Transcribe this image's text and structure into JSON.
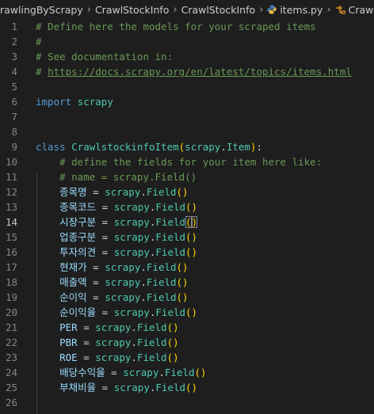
{
  "breadcrumb": {
    "items": [
      "rawlingByScrapy",
      "CrawlStockInfo",
      "CrawlStockInfo",
      "items.py",
      "CrawlstockinfoItem"
    ]
  },
  "editor": {
    "current_line": 14,
    "lines": [
      {
        "n": "1",
        "t": "# Define here the models for your scraped items"
      },
      {
        "n": "2",
        "t": "#"
      },
      {
        "n": "3",
        "t": "# See documentation in:"
      },
      {
        "n": "4",
        "t": "# ",
        "link": "https://docs.scrapy.org/en/latest/topics/items.html"
      },
      {
        "n": "5",
        "t": "import scrapy"
      },
      {
        "n": "6",
        "t": ""
      },
      {
        "n": "7",
        "t": ""
      },
      {
        "n": "8",
        "t": "class CrawlstockinfoItem(scrapy.Item):"
      },
      {
        "n": "9",
        "t": "    # define the fields for your item here like:"
      },
      {
        "n": "10",
        "t": "    # name = scrapy.Field()"
      },
      {
        "n": "11",
        "t": "    종목명 = scrapy.Field()"
      },
      {
        "n": "12",
        "t": "    종목코드 = scrapy.Field()"
      },
      {
        "n": "13",
        "t": "    시장구분 = scrapy.Field()"
      },
      {
        "n": "14",
        "t": "    업종구분 = scrapy.Field()"
      },
      {
        "n": "15",
        "t": "    투자의견 = scrapy.Field()"
      },
      {
        "n": "16",
        "t": "    현재가 = scrapy.Field()"
      },
      {
        "n": "17",
        "t": "    매출액 = scrapy.Field()"
      },
      {
        "n": "18",
        "t": "    순이익 = scrapy.Field()"
      },
      {
        "n": "19",
        "t": "    순이익율 = scrapy.Field()"
      },
      {
        "n": "20",
        "t": "    PER = scrapy.Field()"
      },
      {
        "n": "21",
        "t": "    PBR = scrapy.Field()"
      },
      {
        "n": "22",
        "t": "    ROE = scrapy.Field()"
      },
      {
        "n": "23",
        "t": "    배당수익율 = scrapy.Field()"
      },
      {
        "n": "24",
        "t": "    부채비율 = scrapy.Field()"
      },
      {
        "n": "25",
        "t": ""
      }
    ],
    "line_numbers": [
      "1",
      "2",
      "3",
      "4",
      "5",
      "6",
      "7",
      "8",
      "9",
      "10",
      "11",
      "12",
      "13",
      "14",
      "15",
      "16",
      "17",
      "18",
      "19",
      "20",
      "21",
      "22",
      "23",
      "24",
      "25",
      "26"
    ]
  },
  "colors": {
    "background": "#1e1e1e",
    "comment": "#6a9955",
    "keyword": "#569cd6",
    "class_name": "#4ec9b0",
    "variable": "#9cdcfe",
    "bracket": "#ffd700"
  },
  "icons": {
    "python_file": "python-icon",
    "class_symbol": "class-symbol-icon"
  }
}
